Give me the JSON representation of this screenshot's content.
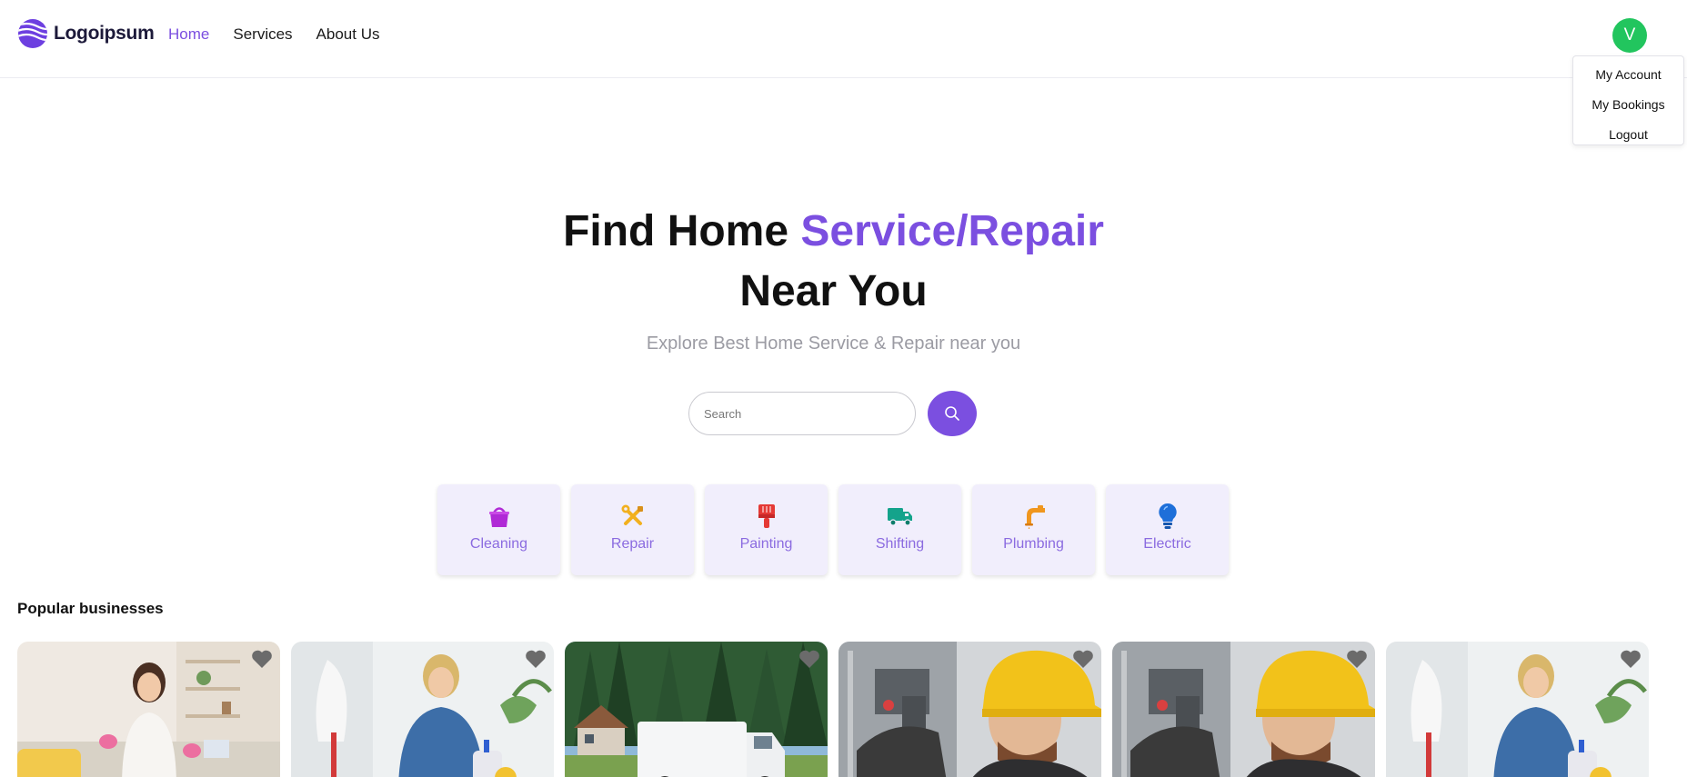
{
  "brand": {
    "name": "Logoipsum"
  },
  "nav": {
    "items": [
      "Home",
      "Services",
      "About Us"
    ],
    "active": "Home"
  },
  "user": {
    "initial": "V",
    "avatar_color": "#22c55e"
  },
  "user_menu": {
    "items": [
      "My Account",
      "My Bookings",
      "Logout"
    ]
  },
  "hero": {
    "title_part1": "Find Home ",
    "title_accent": "Service/Repair",
    "title_part2": "Near You",
    "subtitle": "Explore Best Home Service & Repair near you"
  },
  "search": {
    "placeholder": "Search",
    "value": ""
  },
  "categories": [
    {
      "label": "Cleaning",
      "icon": "bucket-icon",
      "color": "#b02ad6"
    },
    {
      "label": "Repair",
      "icon": "tools-icon",
      "color": "#f2b01e"
    },
    {
      "label": "Painting",
      "icon": "paint-brush-icon",
      "color": "#e53935"
    },
    {
      "label": "Shifting",
      "icon": "truck-icon",
      "color": "#14a38b"
    },
    {
      "label": "Plumbing",
      "icon": "faucet-icon",
      "color": "#f0961e"
    },
    {
      "label": "Electric",
      "icon": "lightbulb-icon",
      "color": "#1e6fd9"
    }
  ],
  "popular": {
    "title": "Popular businesses",
    "cards": [
      {
        "image": "cleaning-woman-photo",
        "favorite_icon": "heart-icon"
      },
      {
        "image": "cleaner-with-mop-photo",
        "favorite_icon": "heart-icon"
      },
      {
        "image": "moving-van-house-photo",
        "favorite_icon": "heart-icon"
      },
      {
        "image": "electrician-hard-hat-photo",
        "favorite_icon": "heart-icon"
      },
      {
        "image": "electrician-hard-hat-photo",
        "favorite_icon": "heart-icon"
      },
      {
        "image": "cleaner-with-mop-photo",
        "favorite_icon": "heart-icon"
      }
    ]
  },
  "colors": {
    "accent": "#7b4fe0",
    "category_bg": "#f1eefc",
    "category_text": "#8b6be0"
  }
}
